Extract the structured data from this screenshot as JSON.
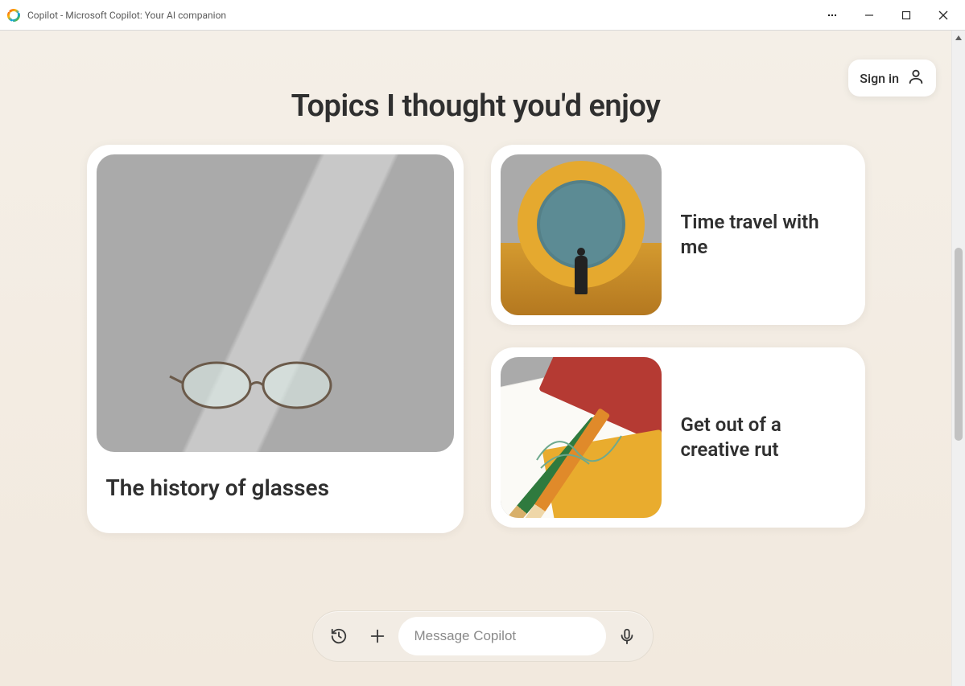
{
  "window": {
    "title": "Copilot - Microsoft Copilot: Your AI companion"
  },
  "signin": {
    "label": "Sign in"
  },
  "heading": "Topics I thought you'd enjoy",
  "cards": {
    "large": {
      "title": "The history of glasses"
    },
    "small1": {
      "title": "Time travel with me"
    },
    "small2": {
      "title": "Get out of a creative rut"
    }
  },
  "composer": {
    "placeholder": "Message Copilot"
  }
}
